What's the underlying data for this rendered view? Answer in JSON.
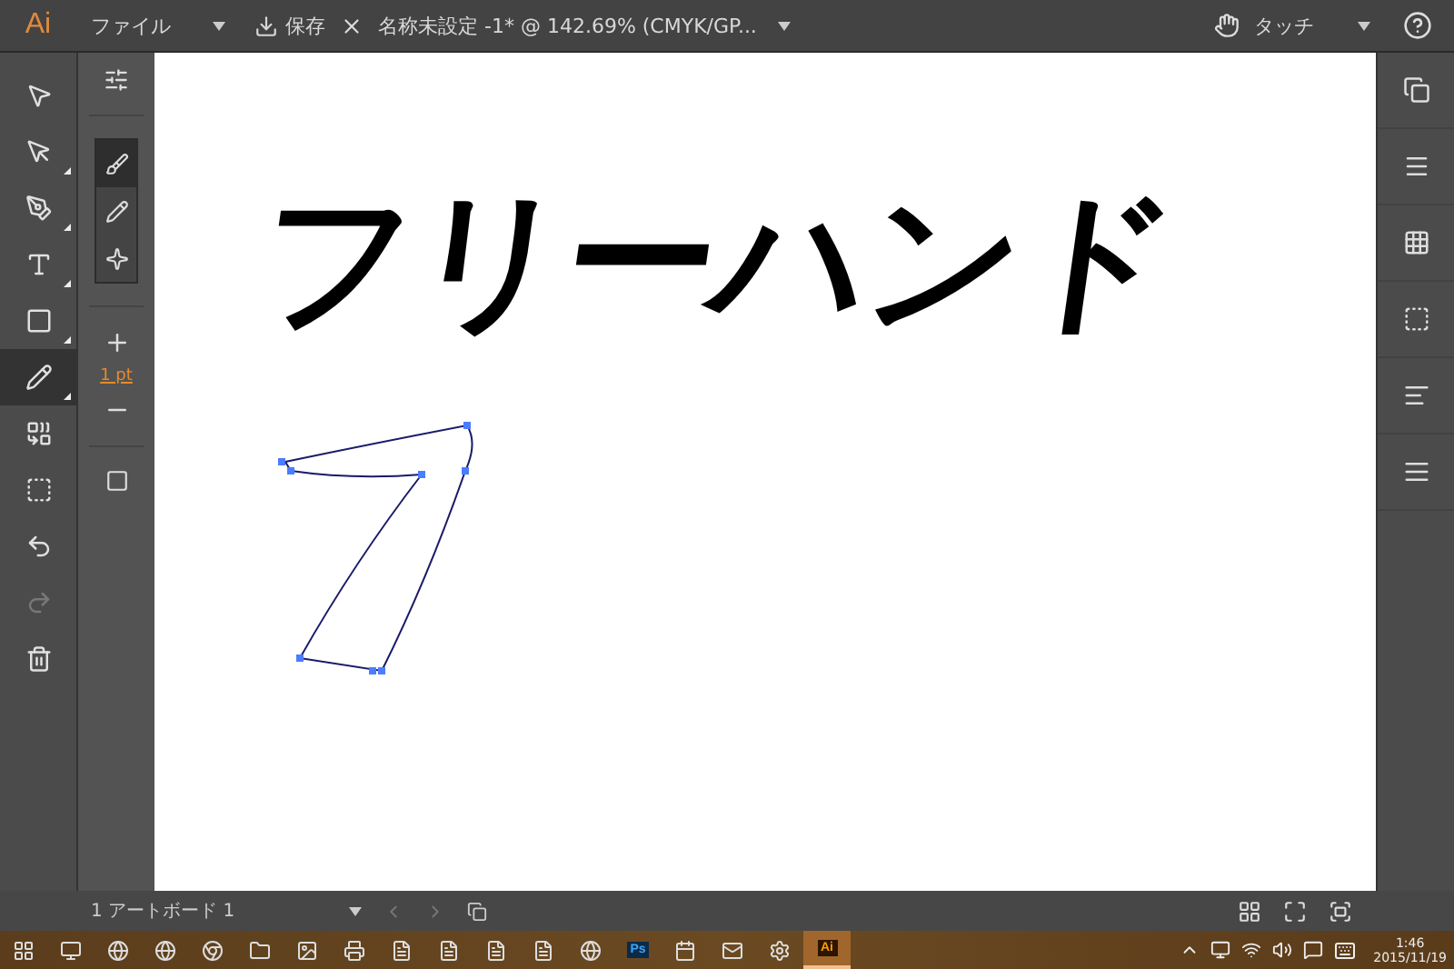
{
  "app_bar": {
    "logo": "Ai",
    "menu": "ファイル",
    "save": "保存",
    "document_title": "名称未設定 -1* @ 142.69% (CMYK/GP...",
    "workspace": "タッチ"
  },
  "tools": [
    {
      "kind": "select",
      "selected": false,
      "submenu": false
    },
    {
      "kind": "direct",
      "selected": false,
      "submenu": true
    },
    {
      "kind": "pen",
      "selected": false,
      "submenu": true
    },
    {
      "kind": "type",
      "selected": false,
      "submenu": true
    },
    {
      "kind": "rect",
      "selected": false,
      "submenu": true
    },
    {
      "kind": "pencil",
      "selected": true,
      "submenu": true
    },
    {
      "kind": "shape",
      "selected": false,
      "submenu": false
    },
    {
      "kind": "artboard",
      "selected": false,
      "submenu": false
    },
    {
      "kind": "undo",
      "selected": false,
      "disabled": false,
      "submenu": false
    },
    {
      "kind": "redo",
      "selected": false,
      "disabled": true,
      "submenu": false
    },
    {
      "kind": "trash",
      "selected": false,
      "disabled": false,
      "submenu": false
    }
  ],
  "tool_options": {
    "brushes": [
      {
        "kind": "smooth",
        "selected": true
      },
      {
        "kind": "pencil",
        "selected": false
      },
      {
        "kind": "sparkle",
        "selected": false
      }
    ],
    "stroke": "1 pt"
  },
  "canvas": {
    "lettering": "フリーハンド"
  },
  "right_panel": [
    {
      "kind": "color"
    },
    {
      "kind": "stroke"
    },
    {
      "kind": "transparency"
    },
    {
      "kind": "transform"
    },
    {
      "kind": "align"
    },
    {
      "kind": "layers"
    }
  ],
  "status_bar": {
    "artboard": "1 アートボード 1"
  },
  "taskbar": {
    "apps": [
      {
        "kind": "start",
        "selected": false
      },
      {
        "kind": "taskview",
        "selected": false
      },
      {
        "kind": "ie",
        "selected": false
      },
      {
        "kind": "edge",
        "selected": false
      },
      {
        "kind": "chrome",
        "selected": false
      },
      {
        "kind": "folder",
        "selected": false
      },
      {
        "kind": "photos",
        "selected": false
      },
      {
        "kind": "printer",
        "selected": false
      },
      {
        "kind": "notes",
        "selected": false
      },
      {
        "kind": "excel",
        "selected": false
      },
      {
        "kind": "onenote",
        "selected": false
      },
      {
        "kind": "word",
        "selected": false
      },
      {
        "kind": "opera",
        "selected": false
      },
      {
        "kind": "ps",
        "selected": false,
        "label": "Ps"
      },
      {
        "kind": "calendar",
        "selected": false
      },
      {
        "kind": "mail",
        "selected": false
      },
      {
        "kind": "settings",
        "selected": false
      },
      {
        "kind": "ai",
        "selected": true,
        "label": "Ai"
      }
    ],
    "time": "1:46",
    "date": "2015/11/19"
  }
}
